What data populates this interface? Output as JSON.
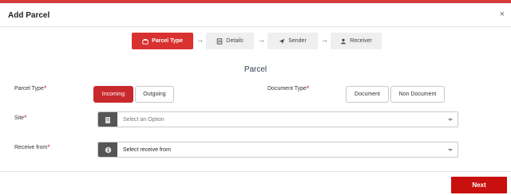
{
  "modal": {
    "title": "Add Parcel",
    "close_glyph": "×"
  },
  "steps": [
    {
      "label": "Parcel Type",
      "icon": "parcel-icon",
      "active": true
    },
    {
      "label": "Details",
      "icon": "details-icon",
      "active": false
    },
    {
      "label": "Sender",
      "icon": "send-icon",
      "active": false
    },
    {
      "label": "Receiver",
      "icon": "user-icon",
      "active": false
    }
  ],
  "step_arrow": "→",
  "section_title": "Parcel",
  "parcel_type": {
    "label": "Parcel Type",
    "required_mark": "*",
    "options": [
      "Incoming",
      "Outgoing"
    ],
    "selected": "Incoming"
  },
  "document_type": {
    "label": "Document Type",
    "required_mark": "*",
    "options": [
      "Document",
      "Non Document"
    ]
  },
  "site": {
    "label": "Site",
    "required_mark": "*",
    "placeholder": "Select an Option",
    "icon": "building-icon"
  },
  "receive_from": {
    "label": "Receive from",
    "required_mark": "*",
    "placeholder": "Select receive from",
    "icon": "info-icon"
  },
  "footer": {
    "next_label": "Next"
  },
  "colors": {
    "accent": "#c8292d",
    "top_bar": "#d63b3b",
    "icon_box": "#555555"
  }
}
